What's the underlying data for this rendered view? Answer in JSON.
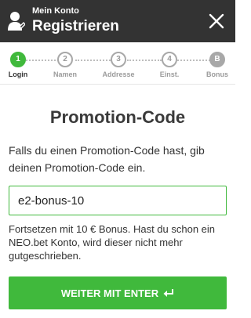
{
  "header": {
    "subtitle": "Mein Konto",
    "title": "Registrieren"
  },
  "steps": [
    {
      "number": "1",
      "label": "Login",
      "active": true
    },
    {
      "number": "2",
      "label": "Namen",
      "active": false
    },
    {
      "number": "3",
      "label": "Addresse",
      "active": false
    },
    {
      "number": "4",
      "label": "Einst.",
      "active": false
    },
    {
      "number": "B",
      "label": "Bonus",
      "active": false
    }
  ],
  "promo": {
    "title": "Promotion-Code",
    "description": "Falls du einen Promotion-Code hast, gib deinen Promotion-Code ein.",
    "input_value": "e2-bonus-10",
    "note": "Fortsetzen mit 10 € Bonus. Hast du schon ein NEO.bet Konto, wird dieser nicht mehr gutgeschrieben.",
    "submit_label": "WEITER MIT ENTER"
  },
  "colors": {
    "header_bg": "#333333",
    "accent": "#40b93c",
    "inactive_step": "#a8a8a8"
  },
  "icons": {
    "user": "user-icon",
    "close": "close-icon",
    "enter": "enter-icon"
  }
}
